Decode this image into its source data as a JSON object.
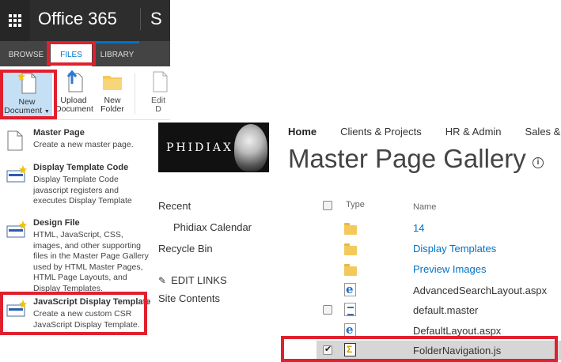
{
  "suite_bar": {
    "app_title": "Office 365",
    "next_letter": "S"
  },
  "ribbon": {
    "tabs": [
      {
        "label": "BROWSE"
      },
      {
        "label": "FILES"
      },
      {
        "label": "LIBRARY"
      }
    ],
    "buttons": {
      "new_document": {
        "line1": "New",
        "line2": "Document"
      },
      "upload_document": {
        "line1": "Upload",
        "line2": "Document"
      },
      "new_folder": {
        "line1": "New",
        "line2": "Folder"
      },
      "edit_document": {
        "line1": "Edit",
        "line2": "D"
      }
    }
  },
  "new_document_menu": [
    {
      "title": "Master Page",
      "description": "Create a new master page."
    },
    {
      "title": "Display Template Code",
      "description": "Display Template Code javascript registers and executes Display Template rendering logic."
    },
    {
      "title": "Design File",
      "description": "HTML, JavaScript, CSS, images, and other supporting files in the Master Page Gallery used by HTML Master Pages, HTML Page Layouts, and Display Templates."
    },
    {
      "title": "JavaScript Display Template",
      "description": "Create a new custom CSR JavaScript Display Template."
    }
  ],
  "top_nav": {
    "items": [
      "Home",
      "Clients & Projects",
      "HR & Admin",
      "Sales &"
    ]
  },
  "logo_text": "PHIDIAX",
  "page_title": "Master Page Gallery",
  "info_icon": "i",
  "quick_launch": {
    "recent": "Recent",
    "recent_item": "Phidiax Calendar",
    "recycle_bin": "Recycle Bin",
    "edit_links": "EDIT LINKS",
    "site_contents": "Site Contents"
  },
  "list": {
    "headers": {
      "type": "Type",
      "name": "Name"
    },
    "rows": [
      {
        "name": "14",
        "icon": "folder-icon"
      },
      {
        "name": "Display Templates",
        "icon": "folder-icon"
      },
      {
        "name": "Preview Images",
        "icon": "folder-icon"
      },
      {
        "name": "AdvancedSearchLayout.aspx",
        "icon": "aspx-icon"
      },
      {
        "name": "default.master",
        "icon": "master-file-icon"
      },
      {
        "name": "DefaultLayout.aspx",
        "icon": "aspx-icon"
      },
      {
        "name": "FolderNavigation.js",
        "icon": "js-file-icon"
      }
    ]
  },
  "colors": {
    "accent": "#0072c6",
    "highlight": "#e0202e",
    "suite_bar": "#2d2d2d"
  }
}
